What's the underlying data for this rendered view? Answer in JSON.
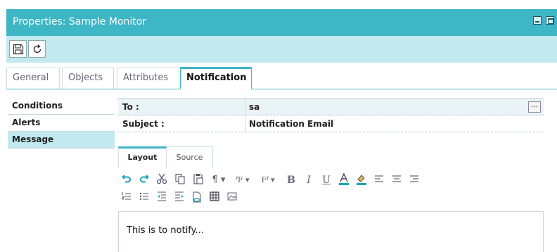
{
  "window": {
    "title": "Properties: Sample Monitor"
  },
  "toolbar": {
    "save_icon": "save-icon",
    "refresh_icon": "refresh-icon"
  },
  "tabs": [
    {
      "label": "General",
      "active": false
    },
    {
      "label": "Objects",
      "active": false
    },
    {
      "label": "Attributes",
      "active": false
    },
    {
      "label": "Notification",
      "active": true
    }
  ],
  "sidenav": {
    "items": [
      {
        "label": "Conditions",
        "selected": false
      },
      {
        "label": "Alerts",
        "selected": false
      },
      {
        "label": "Message",
        "selected": true
      }
    ]
  },
  "fields": {
    "to": {
      "label": "To :",
      "value": "sa",
      "browse_label": "..."
    },
    "subject": {
      "label": "Subject :",
      "value": "Notification Email"
    }
  },
  "editor": {
    "tabs": [
      {
        "label": "Layout",
        "active": true
      },
      {
        "label": "Source",
        "active": false
      }
    ],
    "content": "This is to notify...",
    "toolbar_row1": [
      "undo-icon",
      "redo-icon",
      "cut-icon",
      "copy-icon",
      "paste-icon",
      "paragraph-format-icon",
      "font-name-icon",
      "font-size-icon",
      "bold-icon",
      "italic-icon",
      "underline-icon",
      "font-color-icon",
      "highlight-color-icon",
      "align-left-icon",
      "align-center-icon",
      "align-right-icon"
    ],
    "toolbar_row2": [
      "numbered-list-icon",
      "bulleted-list-icon",
      "outdent-icon",
      "indent-icon",
      "insert-link-icon",
      "insert-table-icon",
      "insert-image-icon"
    ]
  },
  "colors": {
    "accent": "#3db6c6",
    "toolbar_bg": "#c1e9ef",
    "selected_nav_bg": "#c1e9ef",
    "icon_teal": "#1aa4b8"
  }
}
